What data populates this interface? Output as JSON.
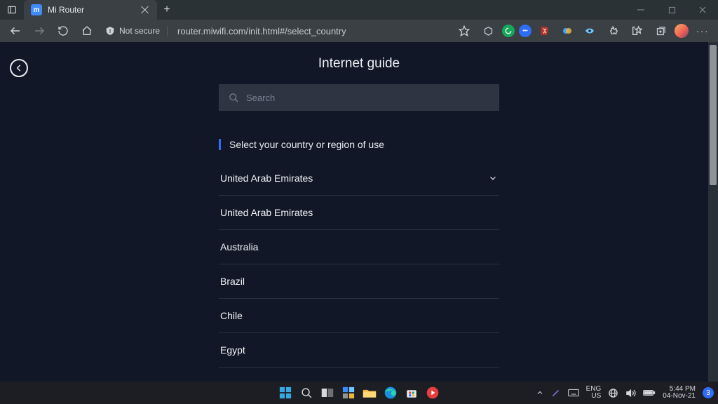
{
  "browser": {
    "tab_title": "Mi Router",
    "not_secure_label": "Not secure",
    "url": "router.miwifi.com/init.html#/select_country"
  },
  "page": {
    "title": "Internet guide",
    "search_placeholder": "Search",
    "section_heading": "Select your country or region of use",
    "selected": "United Arab Emirates",
    "options": [
      "United Arab Emirates",
      "Australia",
      "Brazil",
      "Chile",
      "Egypt"
    ]
  },
  "taskbar": {
    "lang1": "ENG",
    "lang2": "US",
    "time": "5:44 PM",
    "date": "04-Nov-21",
    "badge": "3"
  }
}
